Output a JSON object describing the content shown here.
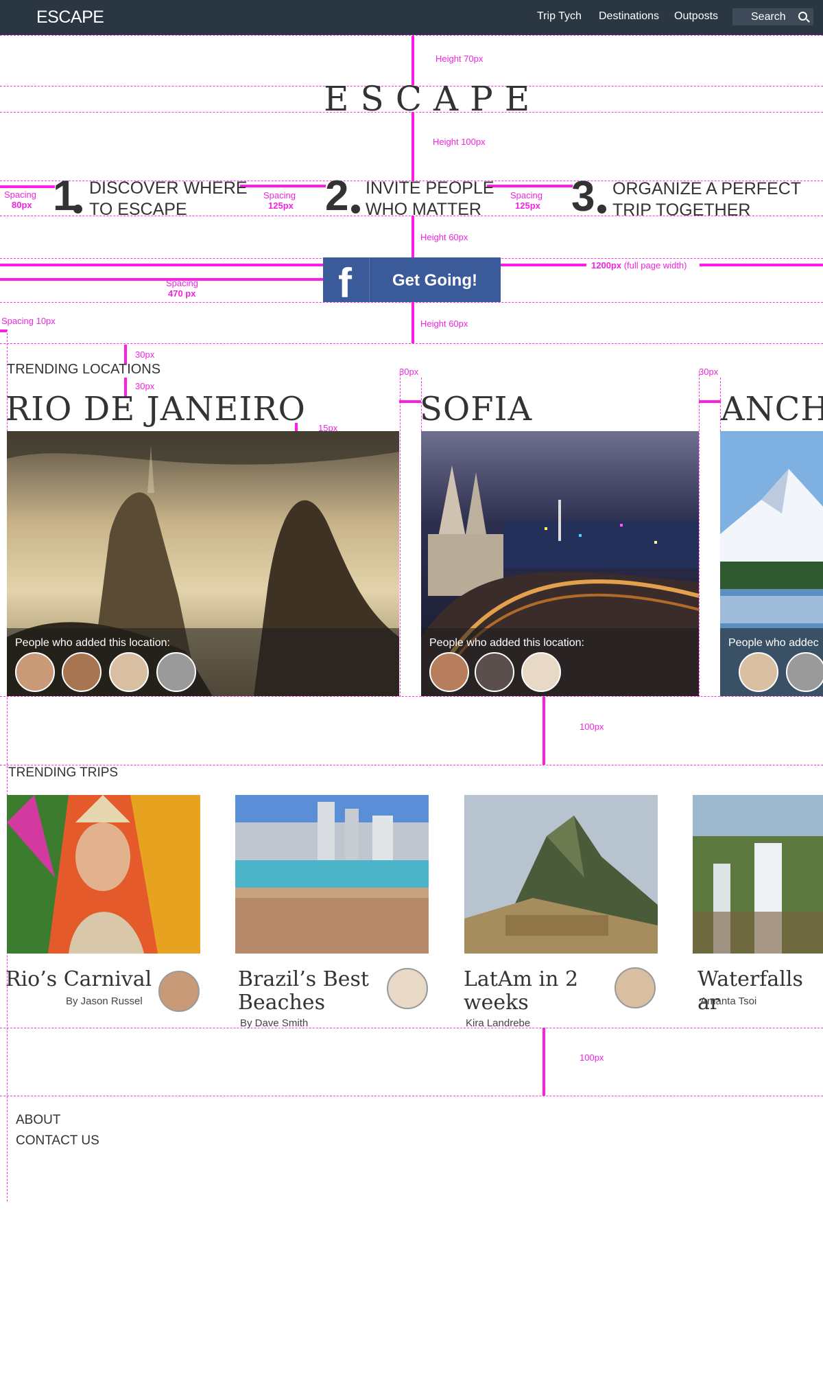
{
  "nav": {
    "logo": "ESCAPE",
    "links": [
      "Trip Tych",
      "Destinations",
      "Outposts"
    ],
    "search_label": "Search",
    "background": "#2b3643"
  },
  "hero": {
    "title": "ESCAPE"
  },
  "steps": [
    {
      "number": "1",
      "line1": "DISCOVER WHERE",
      "line2": "TO ESCAPE"
    },
    {
      "number": "2",
      "line1": "INVITE PEOPLE",
      "line2": "WHO MATTER"
    },
    {
      "number": "3",
      "line1": "ORGANIZE A PERFECT",
      "line2": "TRIP TOGETHER"
    }
  ],
  "cta": {
    "label": "Get Going!",
    "color": "#3b5a99"
  },
  "annotations": {
    "height70": "Height 70px",
    "height100": "Height 100px",
    "height60a": "Height 60px",
    "height60b": "Height 60px",
    "spacing_label": "Spacing",
    "spacing80": "80px",
    "spacing125a": "125px",
    "spacing125b": "125px",
    "fullwidth_bold": "1200px",
    "fullwidth_rest": "(full page width)",
    "spacing470": "470  px",
    "spacing10": "Spacing 10px",
    "px30a": "30px",
    "px30b": "30px",
    "px30c": "30px",
    "px30d": "30px",
    "px15": "15px",
    "px100a": "100px",
    "px100b": "100px",
    "guide_color": "#ff1ce8"
  },
  "trending_locations": {
    "title": "TRENDING LOCATIONS",
    "overlay_label": "People who added this location:",
    "overlay_label_cut": "People who addec",
    "items": [
      {
        "name": "RIO DE JANEIRO"
      },
      {
        "name": "SOFIA"
      },
      {
        "name": "ANCH"
      }
    ]
  },
  "trending_trips": {
    "title": "TRENDING TRIPS",
    "items": [
      {
        "title_line1": "Rio’s Carnival",
        "title_line2": "",
        "author": "By Jason Russel"
      },
      {
        "title_line1": "Brazil’s Best",
        "title_line2": "Beaches",
        "author": "By Dave Smith"
      },
      {
        "title_line1": "LatAm in 2",
        "title_line2": "weeks",
        "author": "Kira Landrebe"
      },
      {
        "title_line1": "Waterfalls ar",
        "title_line2": "",
        "author": "Amanta Tsoi"
      }
    ]
  },
  "footer": {
    "links": [
      "ABOUT",
      "CONTACT US"
    ]
  }
}
